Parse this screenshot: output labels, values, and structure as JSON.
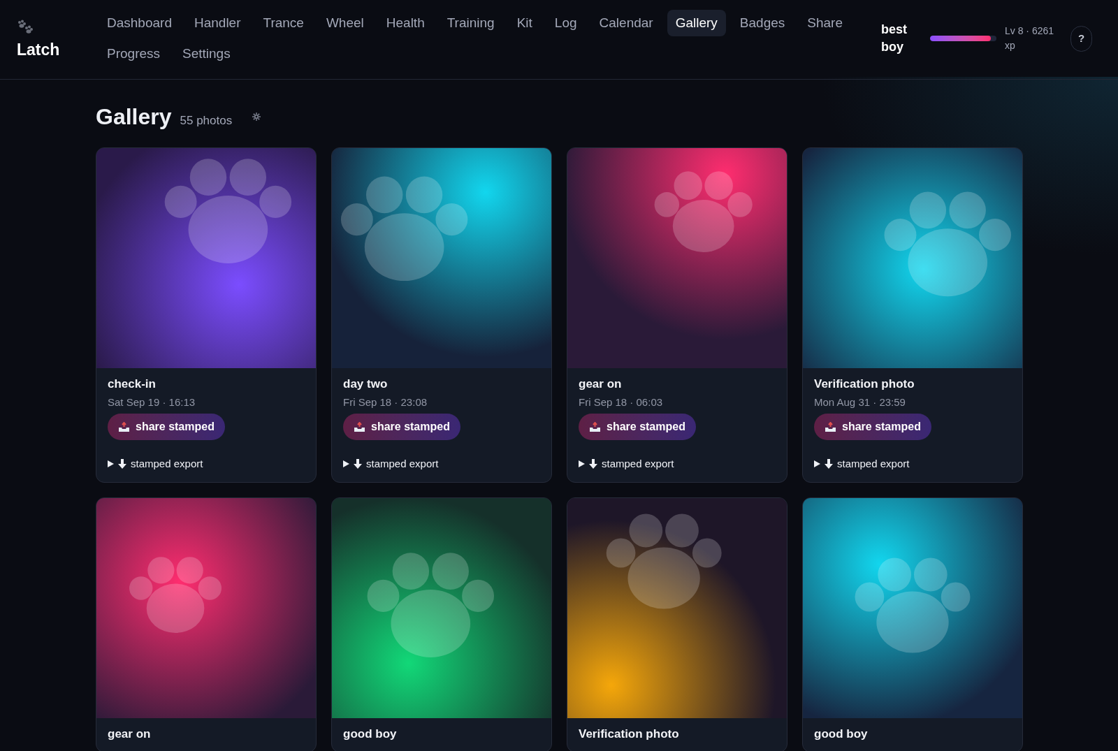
{
  "app": {
    "name": "Latch"
  },
  "nav": [
    {
      "label": "Dashboard",
      "selected": false
    },
    {
      "label": "Handler",
      "selected": false
    },
    {
      "label": "Trance",
      "selected": false
    },
    {
      "label": "Wheel",
      "selected": false
    },
    {
      "label": "Health",
      "selected": false
    },
    {
      "label": "Training",
      "selected": false
    },
    {
      "label": "Kit",
      "selected": false
    },
    {
      "label": "Log",
      "selected": false
    },
    {
      "label": "Calendar",
      "selected": false
    },
    {
      "label": "Gallery",
      "selected": true
    },
    {
      "label": "Badges",
      "selected": false
    },
    {
      "label": "Share",
      "selected": false
    },
    {
      "label": "Progress",
      "selected": false
    },
    {
      "label": "Settings",
      "selected": false
    }
  ],
  "user": {
    "name": "best boy",
    "level": 0.92,
    "xp": "Lv 8 · 6261 xp",
    "help": "?"
  },
  "page": {
    "title": "Gallery",
    "count": "55 photos"
  },
  "photos": [
    {
      "title": "check-in",
      "date": "Sat Sep 19 · 16:13",
      "share": "share stamped",
      "export": "stamped export"
    },
    {
      "title": "day two",
      "date": "Fri Sep 18 · 23:08",
      "share": "share stamped",
      "export": "stamped export"
    },
    {
      "title": "gear on",
      "date": "Fri Sep 18 · 06:03",
      "share": "share stamped",
      "export": "stamped export"
    },
    {
      "title": "Verification photo",
      "date": "Mon Aug 31 · 23:59",
      "share": "share stamped",
      "export": "stamped export"
    },
    {
      "title": "gear on"
    },
    {
      "title": "good boy"
    },
    {
      "title": "Verification photo"
    },
    {
      "title": "good boy"
    }
  ]
}
